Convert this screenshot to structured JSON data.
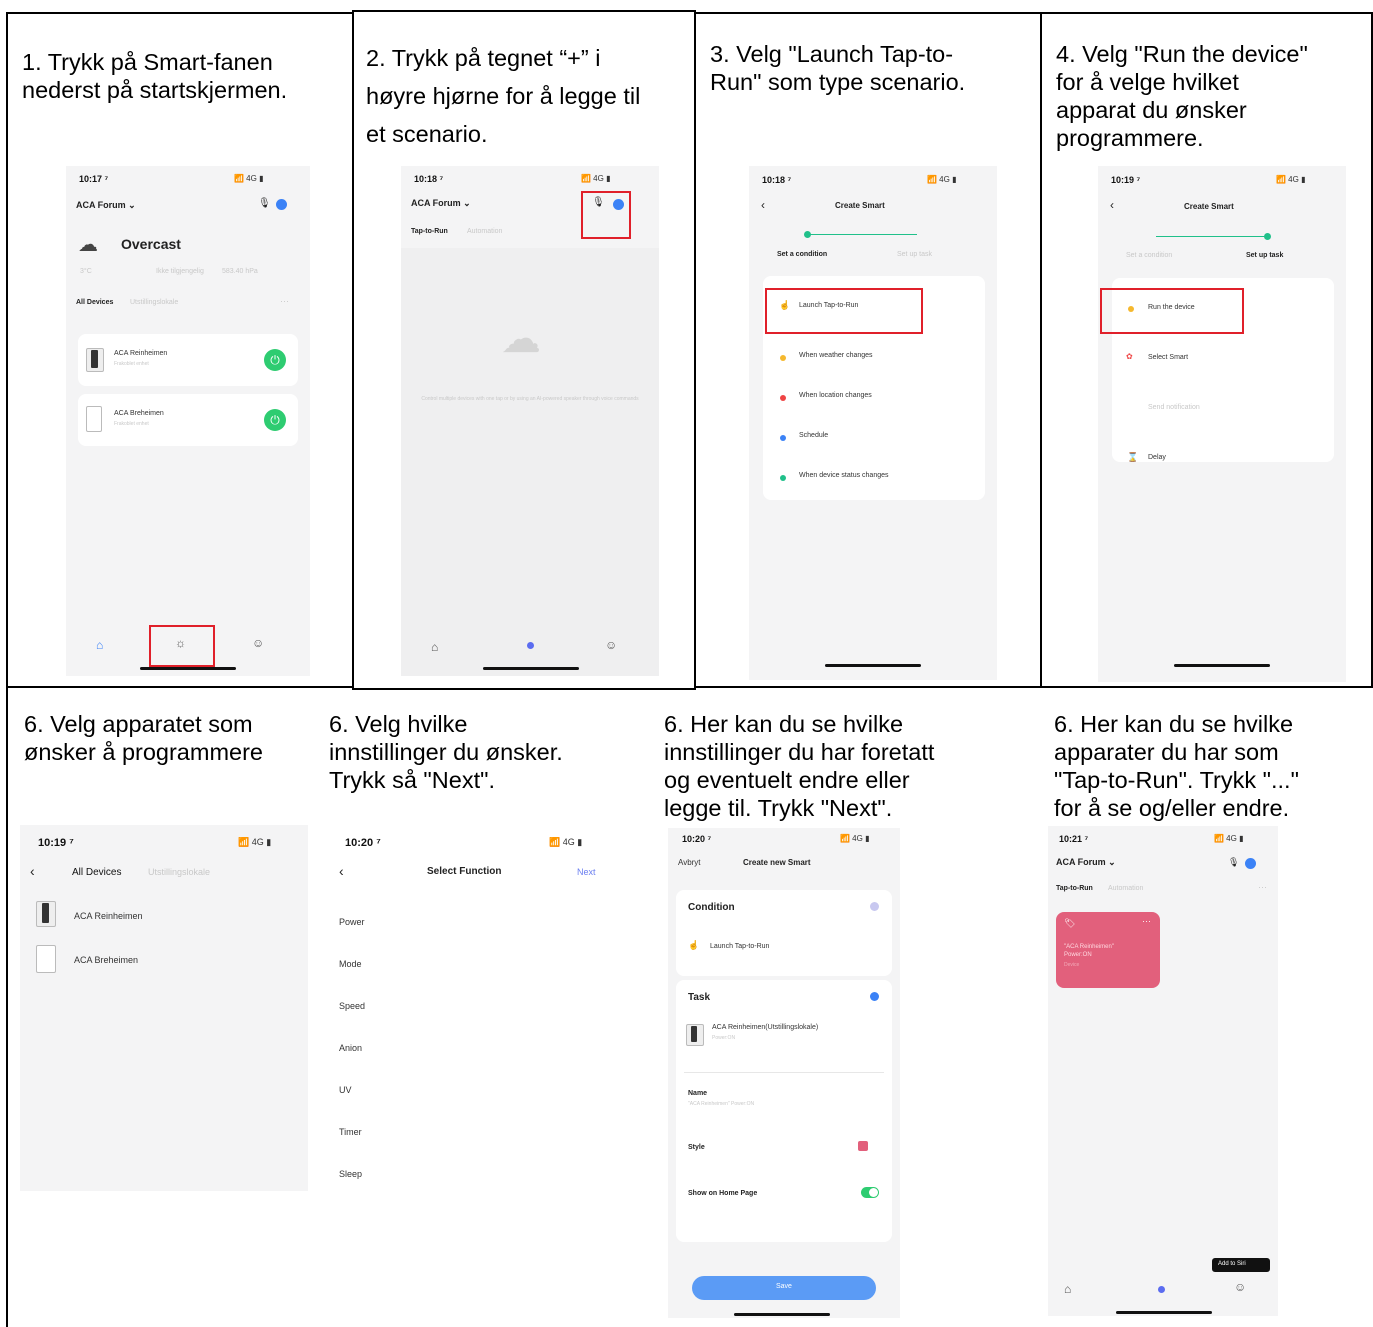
{
  "steps": [
    {
      "text": "1. Trykk på Smart-fanen\nnederst på startskjermen."
    },
    {
      "text": "2. Trykk på tegnet “+” i\nhøyre hjørne for å legge til\net scenario."
    },
    {
      "text": "3. Velg \"Launch Tap-to-\nRun\" som type scenario."
    },
    {
      "text": "4. Velg \"Run the device\"\nfor å velge hvilket\napparat du ønsker\nprogrammere."
    },
    {
      "text": "6. Velg apparatet som\nønsker å programmere"
    },
    {
      "text": "6. Velg hvilke\ninnstillinger du ønsker.\nTrykk så \"Next\"."
    },
    {
      "text": "6. Her kan du se hvilke\ninnstillinger du har foretatt\nog eventuelt endre eller\nlegge til. Trykk \"Next\"."
    },
    {
      "text": "6. Her kan du se hvilke\napparater du har som\n\"Tap-to-Run\". Trykk \"...\"\nfor å se og/eller endre."
    }
  ],
  "screen1": {
    "time": "10:17 ⁷",
    "signal": "📶 4G ▮",
    "home": "ACA Forum ⌄",
    "weather": "Overcast",
    "stats": [
      "3°C",
      "Ikke tilgjengelig",
      "583.40 hPa"
    ],
    "tabs": [
      "All Devices",
      "Utstillingslokale"
    ],
    "devices": [
      "ACA Reinheimen",
      "ACA Breheimen"
    ],
    "device_sub": "Frakoblet enhet"
  },
  "screen2": {
    "time": "10:18 ⁷",
    "signal": "📶 4G ▮",
    "home": "ACA Forum ⌄",
    "tabs": [
      "Tap-to-Run",
      "Automation"
    ],
    "empty_text": "Control multiple devices with one tap or by using an AI-powered speaker through voice commands"
  },
  "screen3": {
    "time": "10:18 ⁷",
    "signal": "📶 4G ▮",
    "title": "Create Smart",
    "step_left": "Set a condition",
    "step_right": "Set up task",
    "options": [
      "Launch Tap-to-Run",
      "When weather changes",
      "When location changes",
      "Schedule",
      "When device status changes"
    ]
  },
  "screen4": {
    "time": "10:19 ⁷",
    "signal": "📶 4G ▮",
    "title": "Create Smart",
    "step_left": "Set a condition",
    "step_right": "Set up task",
    "options": [
      "Run the device",
      "Select Smart",
      "Send notification",
      "Delay"
    ]
  },
  "screen5": {
    "time": "10:19 ⁷",
    "signal": "📶 4G ▮",
    "tabs": [
      "All Devices",
      "Utstillingslokale"
    ],
    "devices": [
      "ACA Reinheimen",
      "ACA Breheimen"
    ]
  },
  "screen6": {
    "time": "10:20 ⁷",
    "signal": "📶 4G ▮",
    "title": "Select Function",
    "next": "Next",
    "functions": [
      "Power",
      "Mode",
      "Speed",
      "Anion",
      "UV",
      "Timer",
      "Sleep"
    ]
  },
  "screen7": {
    "time": "10:20 ⁷",
    "signal": "📶 4G ▮",
    "cancel": "Avbryt",
    "title": "Create new Smart",
    "condition_header": "Condition",
    "condition_item": "Launch Tap-to-Run",
    "task_header": "Task",
    "task_item": "ACA Reinheimen(Utstillingslokale)",
    "task_sub": "Power:ON",
    "name_label": "Name",
    "name_value": "\"ACA Reinheimen\" Power:ON",
    "style_label": "Style",
    "show_label": "Show on Home Page",
    "save": "Save"
  },
  "screen8": {
    "time": "10:21 ⁷",
    "signal": "📶 4G ▮",
    "home": "ACA Forum ⌄",
    "tabs": [
      "Tap-to-Run",
      "Automation"
    ],
    "card_line1": "\"ACA Reinheimen\"",
    "card_line2": "Power:ON",
    "card_sub": "Device",
    "siri": "Add to Siri"
  },
  "colors": {
    "highlight": "#e0202a",
    "accent_blue": "#3b82f6",
    "power_green": "#2ecc71",
    "card_pink": "#e2607c",
    "step_green": "#20c08a"
  }
}
